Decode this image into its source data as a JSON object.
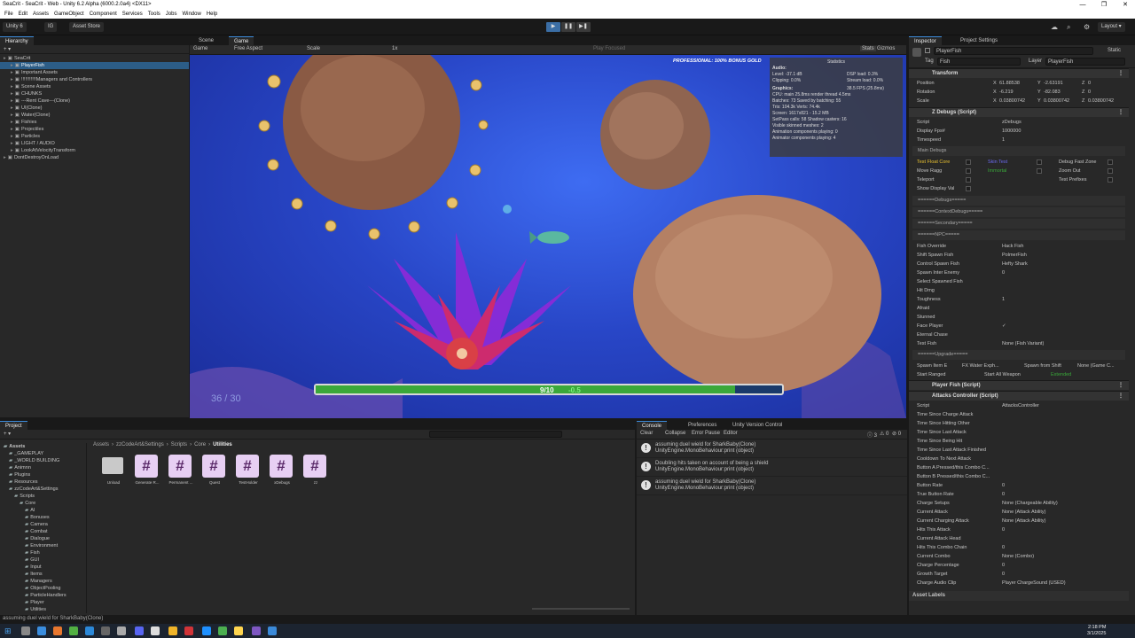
{
  "window": {
    "title": "SeaCrit - SeaCrit - Web - Unity 6.2 Alpha (6000.2.0a4) <DX11>",
    "min": "—",
    "max": "❐",
    "close": "✕"
  },
  "menu": [
    "File",
    "Edit",
    "Assets",
    "GameObject",
    "Component",
    "Services",
    "Tools",
    "Jobs",
    "Window",
    "Help"
  ],
  "toolbar": {
    "account": "Unity 6",
    "cloud": "IG",
    "asset_store": "Asset Store",
    "layout": "Layout"
  },
  "hierarchy": {
    "tab": "Hierarchy",
    "items": [
      {
        "label": "SeaCrit",
        "indent": 0,
        "sel": false
      },
      {
        "label": "PlayerFish",
        "indent": 1,
        "sel": true
      },
      {
        "label": "Important Assets",
        "indent": 1,
        "sel": false
      },
      {
        "label": "!!!!!!!!!!!Managers and Controllers",
        "indent": 1,
        "sel": false
      },
      {
        "label": "Scene Assets",
        "indent": 1,
        "sel": false
      },
      {
        "label": "CHUNKS",
        "indent": 1,
        "sel": false
      },
      {
        "label": "---Rent Cave---(Clone)",
        "indent": 1,
        "sel": false
      },
      {
        "label": "UI(Clone)",
        "indent": 1,
        "sel": false
      },
      {
        "label": "Water(Clone)",
        "indent": 1,
        "sel": false
      },
      {
        "label": "Fishies",
        "indent": 1,
        "sel": false
      },
      {
        "label": "Projectiles",
        "indent": 1,
        "sel": false
      },
      {
        "label": "Particles",
        "indent": 1,
        "sel": false
      },
      {
        "label": "LIGHT / AUDIO",
        "indent": 1,
        "sel": false
      },
      {
        "label": "LookAtVelocityTransform",
        "indent": 1,
        "sel": false
      },
      {
        "label": "DontDestroyOnLoad",
        "indent": 0,
        "sel": false
      }
    ]
  },
  "scene_tabs": {
    "scene": "Scene",
    "game": "Game"
  },
  "game_bar": {
    "display": "Game",
    "aspect": "Free Aspect",
    "scale_label": "Scale",
    "scale_value": "1x",
    "play_focused": "Play Focused",
    "stats": "Stats",
    "gizmos": "Gizmos"
  },
  "game": {
    "banner": "PROFESSIONAL: 100% BONUS GOLD",
    "health": "9/10",
    "health_delta": "-0.5",
    "health_fraction": 0.9,
    "ammo": "36 / 30"
  },
  "stats": {
    "title": "Statistics",
    "audio_h": "Audio:",
    "audio_l1": "Level: -37.1 dB",
    "audio_r1": "DSP load: 0.3%",
    "audio_l2": "Clipping: 0.0%",
    "audio_r2": "Stream load: 0.0%",
    "graphics_h": "Graphics:",
    "fps": "38.5 FPS (25.8ms)",
    "lines": [
      "CPU: main 25.8ms  render thread 4.5ms",
      "Batches: 73     Saved by batching: 55",
      "Tris: 104.3k    Verts: 74.4k",
      "Screen: 1617x821 - 15.2 MB",
      "SetPass calls: 58     Shadow casters: 16",
      "Visible skinned meshes: 2",
      "Animation components playing: 0",
      "Animator components playing: 4"
    ]
  },
  "project": {
    "tab": "Project",
    "tree": [
      "Assets",
      "_GAMEPLAY",
      "_WORLD BUILDING",
      "Animnn",
      "Plugins",
      "Resources",
      "zzCodeArt&Settings",
      "Scripts",
      "Core",
      "AI",
      "Bonuses",
      "Camera",
      "Combat",
      "Dialogue",
      "Environment",
      "Fish",
      "GUI",
      "Input",
      "Items",
      "Managers",
      "ObjectPooling",
      "ParticleHandlers",
      "Player",
      "Utilities"
    ],
    "breadcrumb": [
      "Assets",
      "zzCodeArt&Settings",
      "Scripts",
      "Core",
      "Utilities"
    ],
    "files": [
      "Unload",
      "Generate R...",
      "Permanent ...",
      "Quest",
      "TestHolder",
      "xDebugs",
      "zz"
    ]
  },
  "console": {
    "tabs": [
      "Console",
      "Preferences",
      "Unity Version Control"
    ],
    "controls": [
      "Clear",
      "Collapse",
      "Error Pause",
      "Editor"
    ],
    "counts": [
      "3",
      "0",
      "0"
    ],
    "messages": [
      {
        "l1": "assuming duel wield for SharkBaby(Clone)",
        "l2": "UnityEngine.MonoBehaviour:print (object)"
      },
      {
        "l1": "Doubling hits taken on account of being a shield",
        "l2": "UnityEngine.MonoBehaviour:print (object)"
      },
      {
        "l1": "assuming duel wield for SharkBaby(Clone)",
        "l2": "UnityEngine.MonoBehaviour:print (object)"
      }
    ]
  },
  "inspector": {
    "tabs": [
      "Inspector",
      "Project Settings"
    ],
    "object_name": "PlayerFish",
    "static": "Static",
    "tag_label": "Tag",
    "tag": "Fish",
    "layer_label": "Layer",
    "layer": "PlayerFish",
    "transform": {
      "title": "Transform",
      "position": [
        "Position",
        "61.88538",
        "-2.63191",
        "0"
      ],
      "rotation": [
        "Rotation",
        "-6.219",
        "-82.083",
        "0"
      ],
      "scale": [
        "Scale",
        "0.03800742",
        "0.03800742",
        "0.03800742"
      ]
    },
    "zdebug": "Z Debugs (Script)",
    "script_label": "Script",
    "script_value": "zDebugs",
    "display_fps": "Display Fps#",
    "display_fps_value": "1000000",
    "timespeed": "Timespeed",
    "timespeed_value": "1",
    "main_debugs": "Main Debugs",
    "debug_grid": [
      [
        "Test Float Core",
        "Skin Test",
        "Debug Fast Zone"
      ],
      [
        "Move Ragg",
        "Immortal",
        "Zoom Out"
      ],
      [
        "Teleport",
        "",
        "Test Prefixes"
      ],
      [
        "Show Display Val",
        "",
        ""
      ]
    ],
    "separators": [
      "======Debugs=====",
      "======ContextDebugs=====",
      "======Secondary=====",
      "======NPC====="
    ],
    "npc_rows": [
      [
        "Fish Override",
        "Hack Fish"
      ],
      [
        "Shift Spawn Fish",
        "PolmerFish"
      ],
      [
        "Control Spawn Fish",
        "Hefty Shark"
      ],
      [
        "Spawn Inter Enemy",
        "0"
      ],
      [
        "Select Spawned Fish",
        ""
      ],
      [
        "Hit Dmg",
        ""
      ],
      [
        "Toughness",
        "1"
      ],
      [
        "Afraid",
        ""
      ],
      [
        "Stunned",
        ""
      ],
      [
        "Face Player",
        "✓"
      ],
      [
        "Eternal Chase",
        ""
      ],
      [
        "Test Fish",
        "None (Fish Variant)"
      ]
    ],
    "upgrade_sep": "======Upgrade=====",
    "spawn_item": "Spawn Item E",
    "spawn_item_v1": "FX Water Exph...",
    "spawn_item_v2": "Spawn from Shift",
    "spawn_item_v3": "None (Game C...",
    "start_ranged": "Start Ranged",
    "start_all_weapon": "Start All Weapon",
    "extended": "Extended",
    "player_fish_script": "Player Fish (Script)",
    "attack_script": "Attacks Controller (Script)",
    "attack_script_value": "AttacksController",
    "attack_rows": [
      [
        "Time Since Charge Attack",
        ""
      ],
      [
        "Time Since Hitting Other",
        ""
      ],
      [
        "Time Since Last Attack",
        ""
      ],
      [
        "Time Since Being Hit",
        ""
      ],
      [
        "Time Since Last Attack Finished",
        ""
      ],
      [
        "Cooldown To Next Attack",
        ""
      ],
      [
        "Button A Pressed/this Combo C...",
        ""
      ],
      [
        "Button B Pressed/this Combo C...",
        ""
      ],
      [
        "Button Rate",
        "0"
      ],
      [
        "True Button Rate",
        "0"
      ],
      [
        "Charge Setups",
        "None (Chargeable Ability)"
      ],
      [
        "Current Attack",
        "None (Attack Ability)"
      ],
      [
        "Current Charging Attack",
        "None (Attack Ability)"
      ],
      [
        "Hits This Attack",
        "0"
      ],
      [
        "Current Attack Head",
        ""
      ],
      [
        "Hits This Combo Chain",
        "0"
      ],
      [
        "Current Combo",
        "None (Combo)"
      ],
      [
        "Charge Percentage",
        "0"
      ],
      [
        "Growth Target",
        "0"
      ],
      [
        "Charge Audio Clip",
        "Player ChargeSound (USED)"
      ]
    ],
    "asset_labels": "Asset Labels"
  },
  "status_bar": {
    "message": "assuming duel wield for SharkBaby(Clone)"
  },
  "taskbar": {
    "time": "2:18 PM",
    "date": "3/1/2025"
  },
  "colors": {
    "accent": "#3b8ad9",
    "selection": "#2c5d87",
    "game_bg": "#2a4fd4",
    "health_green": "#3aa83a"
  }
}
